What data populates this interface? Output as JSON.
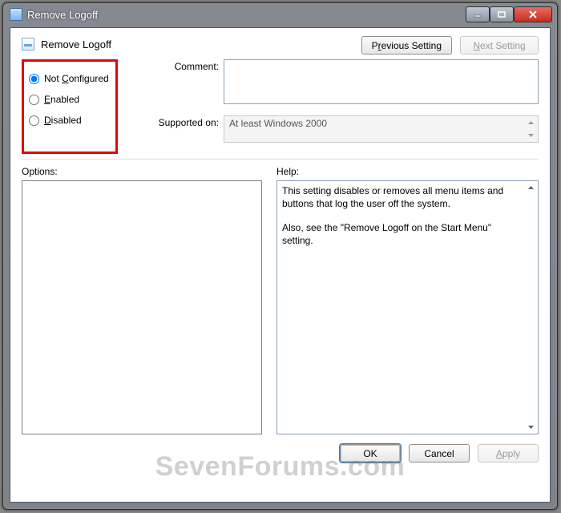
{
  "window": {
    "title": "Remove Logoff"
  },
  "header": {
    "policy_name": "Remove Logoff"
  },
  "nav": {
    "previous_label_pre": "P",
    "previous_label_ul": "r",
    "previous_label_post": "evious Setting",
    "next_label_ul": "N",
    "next_label_post": "ext Setting"
  },
  "states": {
    "not_configured_pre": "Not ",
    "not_configured_ul": "C",
    "not_configured_post": "onfigured",
    "enabled_ul": "E",
    "enabled_post": "nabled",
    "disabled_ul": "D",
    "disabled_post": "isabled",
    "selected": "not_configured"
  },
  "fields": {
    "comment_label": "Comment:",
    "comment_value": "",
    "supported_label": "Supported on:",
    "supported_value": "At least Windows 2000"
  },
  "lower": {
    "options_label": "Options:",
    "help_label": "Help:",
    "help_para1": "This setting disables or removes all menu items and buttons that log the user off the system.",
    "help_para2": "Also, see the \"Remove Logoff on the Start Menu\" setting."
  },
  "footer": {
    "ok_label": "OK",
    "cancel_label": "Cancel",
    "apply_ul": "A",
    "apply_post": "pply"
  },
  "watermark": "SevenForums.com"
}
